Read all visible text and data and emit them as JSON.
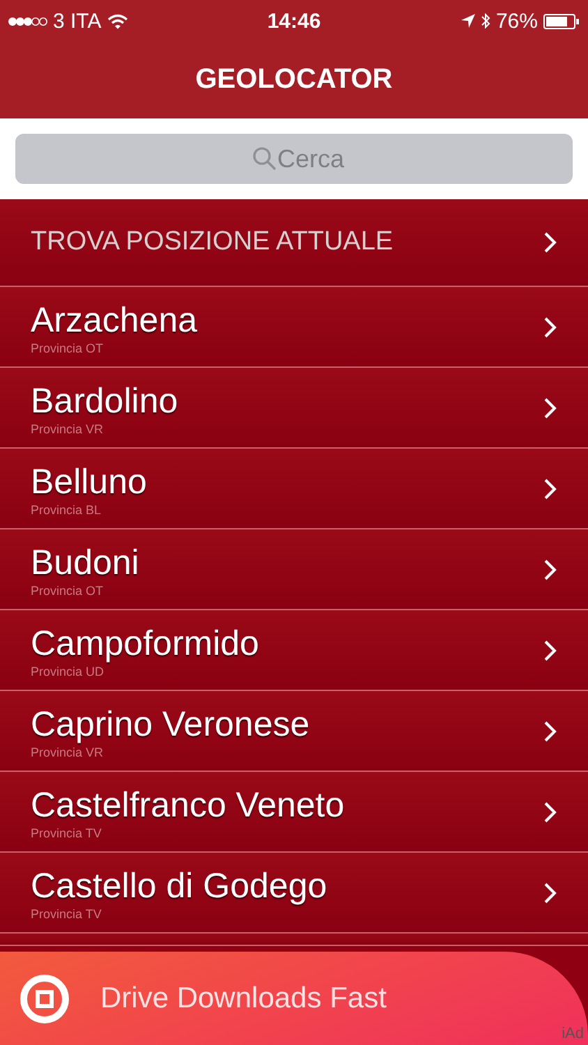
{
  "status_bar": {
    "carrier": "3 ITA",
    "time": "14:46",
    "battery": "76%"
  },
  "nav": {
    "title": "GEOLOCATOR"
  },
  "search": {
    "placeholder": "Cerca"
  },
  "action": {
    "label": "TROVA POSIZIONE ATTUALE"
  },
  "places": [
    {
      "name": "Arzachena",
      "province": "Provincia OT"
    },
    {
      "name": "Bardolino",
      "province": "Provincia VR"
    },
    {
      "name": "Belluno",
      "province": "Provincia BL"
    },
    {
      "name": "Budoni",
      "province": "Provincia OT"
    },
    {
      "name": "Campoformido",
      "province": "Provincia UD"
    },
    {
      "name": "Caprino Veronese",
      "province": "Provincia VR"
    },
    {
      "name": "Castelfranco Veneto",
      "province": "Provincia TV"
    },
    {
      "name": "Castello di Godego",
      "province": "Provincia TV"
    }
  ],
  "ad": {
    "text": "Drive Downloads Fast",
    "badge": "iAd"
  }
}
